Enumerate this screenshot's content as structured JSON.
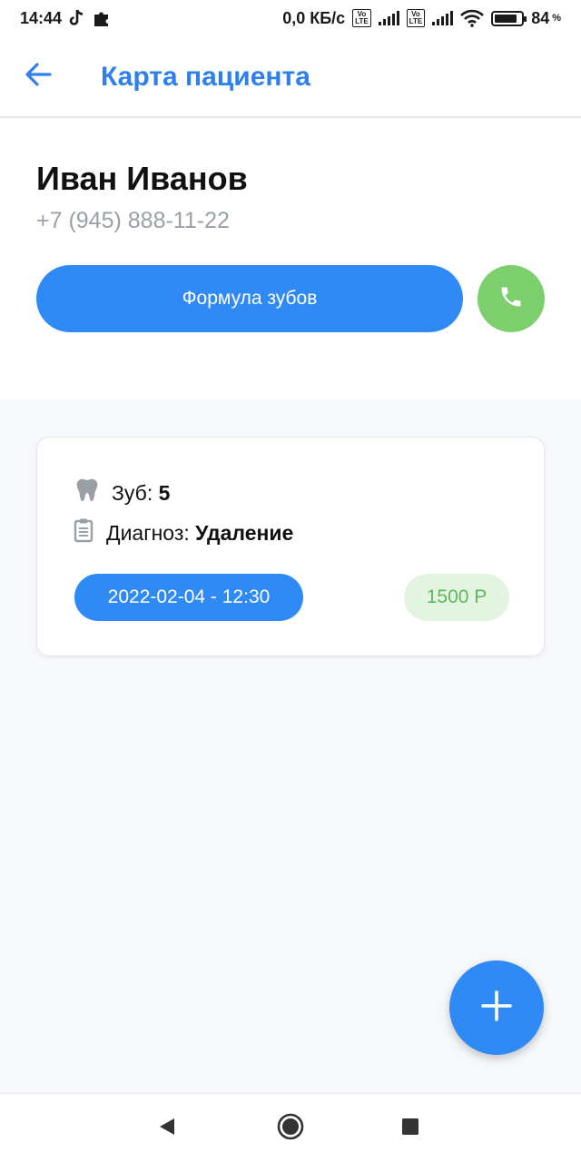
{
  "status_bar": {
    "time": "14:44",
    "net_speed": "0,0 КБ/с",
    "volte_label": "Vo\nLTE",
    "battery_percent": "84",
    "battery_level": 0.84,
    "percent_sign": "%",
    "icons": [
      "tiktok-icon",
      "puzzle-icon",
      "volte-icon",
      "signal-icon",
      "wifi-icon",
      "battery-icon"
    ]
  },
  "app_bar": {
    "title": "Карта пациента",
    "back_icon": "arrow-left-icon"
  },
  "patient": {
    "name": "Иван Иванов",
    "phone": "+7 (945) 888-11-22",
    "formula_button_label": "Формула зубов",
    "call_icon": "phone-icon"
  },
  "visit": {
    "tooth_label": "Зуб: ",
    "tooth_value": "5",
    "diagnosis_label": "Диагноз: ",
    "diagnosis_value": "Удаление",
    "datetime": "2022-02-04 - 12:30",
    "price": "1500 Р"
  },
  "colors": {
    "accent": "#2f8af5",
    "title_blue": "#2f80ed",
    "call_green": "#7ccf6c",
    "price_text": "#5cb85c",
    "price_bg": "#e3f5e0",
    "content_bg": "#f6f8fc"
  },
  "fab_icon": "plus-icon",
  "nav_bar": {
    "icons": [
      "back-triangle-icon",
      "home-circle-icon",
      "recents-square-icon"
    ]
  }
}
